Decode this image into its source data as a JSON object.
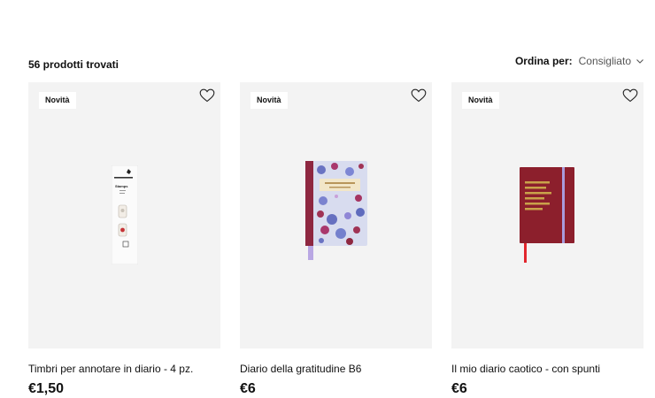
{
  "results": {
    "count_label": "56 prodotti trovati"
  },
  "sort": {
    "label": "Ordina per:",
    "value": "Consigliato"
  },
  "products": [
    {
      "badge": "Novità",
      "title": "Timbri per annotare in diario - 4 pz.",
      "price": "€1,50",
      "image_icon": "stamp-kit-image",
      "image_text": [
        "Stamps"
      ]
    },
    {
      "badge": "Novità",
      "title": "Diario della gratitudine B6",
      "price": "€6",
      "image_icon": "floral-notebook-image"
    },
    {
      "badge": "Novità",
      "title": "Il mio diario caotico - con spunti",
      "price": "€6",
      "image_icon": "red-notebook-image"
    }
  ],
  "colors": {
    "card_bg": "#f3f3f3",
    "text": "#111111",
    "muted": "#555555"
  }
}
